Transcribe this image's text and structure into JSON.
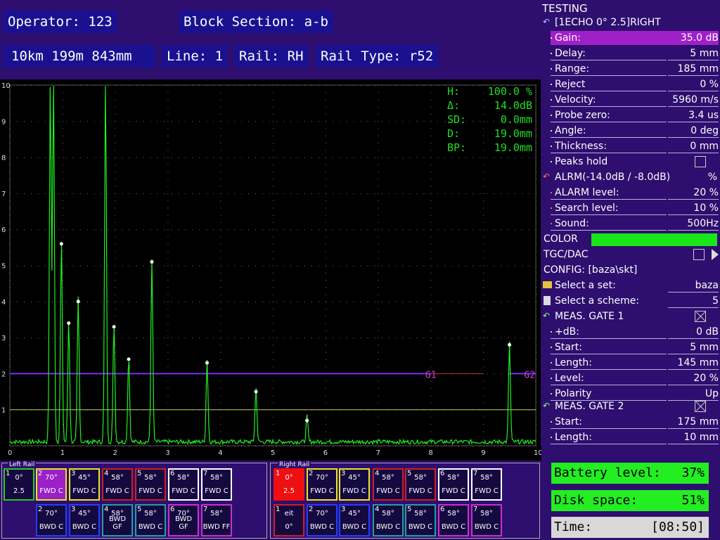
{
  "header": {
    "operator": "Operator: 123",
    "block_section": "Block Section: a-b",
    "distance": "10km 199m 843mm",
    "line": "Line: 1",
    "rail": "Rail: RH",
    "rail_type": "Rail Type: r52"
  },
  "scope": {
    "readouts": [
      {
        "label": "H:",
        "value": "100.0 %"
      },
      {
        "label": "Δ:",
        "value": "14.0dB"
      },
      {
        "label": "SD:",
        "value": "0.0mm"
      },
      {
        "label": "D:",
        "value": "19.0mm"
      },
      {
        "label": "BP:",
        "value": "19.0mm"
      }
    ],
    "y_ticks": [
      "1",
      "2",
      "3",
      "4",
      "5",
      "6",
      "7",
      "8",
      "9",
      "10"
    ],
    "x_ticks": [
      "0",
      "1",
      "2",
      "3",
      "4",
      "5",
      "6",
      "7",
      "8",
      "9",
      "10"
    ],
    "gate1_label": "G1",
    "gate2_label": "G2",
    "colors": {
      "signal": "#22ee22",
      "gate1": "#7b2cff",
      "gate2": "#c83030",
      "reference": "#c8c860"
    }
  },
  "chart_data": {
    "type": "line",
    "x_range": [
      0,
      10
    ],
    "y_range": [
      0,
      10
    ],
    "gates": [
      {
        "name": "G1",
        "level": 2.0,
        "start": 0,
        "end": 7.7
      },
      {
        "name": "G2",
        "level": 2.0,
        "start": 7.7,
        "end": 10
      }
    ],
    "reference_level": 1.0,
    "peaks": [
      {
        "x": 0.77,
        "y": 10.0
      },
      {
        "x": 0.83,
        "y": 10.0
      },
      {
        "x": 0.98,
        "y": 5.6
      },
      {
        "x": 1.12,
        "y": 3.4
      },
      {
        "x": 1.3,
        "y": 4.0
      },
      {
        "x": 1.82,
        "y": 10.0
      },
      {
        "x": 1.98,
        "y": 3.3
      },
      {
        "x": 2.26,
        "y": 2.4
      },
      {
        "x": 2.7,
        "y": 5.1
      },
      {
        "x": 3.75,
        "y": 2.3
      },
      {
        "x": 4.68,
        "y": 1.5
      },
      {
        "x": 5.65,
        "y": 0.7
      },
      {
        "x": 9.5,
        "y": 2.8
      }
    ]
  },
  "panel": {
    "title": "TESTING",
    "echo_header": "[1ECHO 0° 2.5]RIGHT",
    "rows": [
      {
        "label": "Gain:",
        "value": "35.0 dB",
        "selected": true
      },
      {
        "label": "Delay:",
        "value": "5 mm"
      },
      {
        "label": "Range:",
        "value": "185 mm"
      },
      {
        "label": "Reject",
        "value": "0 %"
      },
      {
        "label": "Velocity:",
        "value": "5960 m/s"
      },
      {
        "label": "Probe zero:",
        "value": "3.4 us"
      },
      {
        "label": "Angle:",
        "value": "0 deg"
      },
      {
        "label": "Thickness:",
        "value": "0 mm"
      },
      {
        "label": "Peaks hold",
        "value": ""
      }
    ],
    "alarm_header": "ALRM(-14.0dB / -8.0dB)",
    "alarm_unit": "%",
    "alarm_rows": [
      {
        "label": "ALARM level:",
        "value": "20 %"
      },
      {
        "label": "Search level:",
        "value": "10 %"
      },
      {
        "label": "Sound:",
        "value": "500Hz"
      }
    ],
    "color_label": "COLOR",
    "color_value": "#19e619",
    "tgc_label": "TGC/DAC",
    "config_label": "CONFIG: [baza\\skt]",
    "set_label": "Select a set:",
    "set_value": "baza",
    "scheme_label": "Select a scheme:",
    "scheme_value": "5",
    "gate1_header": "MEAS. GATE 1",
    "gate1_rows": [
      {
        "label": "+dB:",
        "value": "0 dB"
      },
      {
        "label": "Start:",
        "value": "5 mm"
      },
      {
        "label": "Length:",
        "value": "145 mm"
      },
      {
        "label": "Level:",
        "value": "20 %"
      },
      {
        "label": "Polarity",
        "value": "Up"
      }
    ],
    "gate2_header": "MEAS. GATE 2",
    "gate2_rows": [
      {
        "label": "Start:",
        "value": "175 mm"
      },
      {
        "label": "Length:",
        "value": "10 mm"
      }
    ]
  },
  "left_rail": {
    "title": "Left Rail",
    "top": [
      {
        "n": "1",
        "angle": "0°",
        "mode": "2.5",
        "color": "#22cc22",
        "bg": ""
      },
      {
        "n": "2",
        "angle": "70°",
        "mode": "FWD C",
        "color": "#e8e820",
        "bg": "#9a20c8"
      },
      {
        "n": "3",
        "angle": "45°",
        "mode": "FWD C",
        "color": "#e8e820",
        "bg": ""
      },
      {
        "n": "4",
        "angle": "58°",
        "mode": "FWD C",
        "color": "#cc2020",
        "bg": ""
      },
      {
        "n": "5",
        "angle": "58°",
        "mode": "FWD C",
        "color": "#cc2020",
        "bg": ""
      },
      {
        "n": "6",
        "angle": "58°",
        "mode": "FWD C",
        "color": "#ffffff",
        "bg": ""
      },
      {
        "n": "7",
        "angle": "58°",
        "mode": "FWD C",
        "color": "#ffffff",
        "bg": ""
      }
    ],
    "bottom": [
      {
        "n": "2",
        "angle": "70°",
        "mode": "BWD C",
        "color": "#2040ff"
      },
      {
        "n": "3",
        "angle": "45°",
        "mode": "BWD C",
        "color": "#2040ff"
      },
      {
        "n": "4",
        "angle": "58°",
        "mode": "BWD GF",
        "color": "#20a0a0"
      },
      {
        "n": "5",
        "angle": "58°",
        "mode": "BWD C",
        "color": "#20a0a0"
      },
      {
        "n": "6",
        "angle": "70°",
        "mode": "BWD GF",
        "color": "#cc30cc"
      },
      {
        "n": "7",
        "angle": "58°",
        "mode": "BWD FF",
        "color": "#cc30cc"
      }
    ]
  },
  "right_rail": {
    "title": "Right Rail",
    "top": [
      {
        "n": "1",
        "angle": "0°",
        "mode": "2.5",
        "color": "#ee1010",
        "bg": "#ee1010"
      },
      {
        "n": "2",
        "angle": "70°",
        "mode": "FWD C",
        "color": "#e8e820",
        "bg": ""
      },
      {
        "n": "3",
        "angle": "45°",
        "mode": "FWD C",
        "color": "#e8e820",
        "bg": ""
      },
      {
        "n": "4",
        "angle": "58°",
        "mode": "FWD C",
        "color": "#cc2020",
        "bg": ""
      },
      {
        "n": "5",
        "angle": "58°",
        "mode": "FWD C",
        "color": "#cc2020",
        "bg": ""
      },
      {
        "n": "6",
        "angle": "58°",
        "mode": "FWD C",
        "color": "#ffffff",
        "bg": ""
      },
      {
        "n": "7",
        "angle": "58°",
        "mode": "FWD C",
        "color": "#ffffff",
        "bg": ""
      }
    ],
    "bottom": [
      {
        "n": "1",
        "angle": "eit",
        "mode": "0°",
        "color": "#cc2020"
      },
      {
        "n": "2",
        "angle": "70°",
        "mode": "BWD C",
        "color": "#2040ff"
      },
      {
        "n": "3",
        "angle": "45°",
        "mode": "BWD C",
        "color": "#2040ff"
      },
      {
        "n": "4",
        "angle": "58°",
        "mode": "BWD C",
        "color": "#20a0a0"
      },
      {
        "n": "5",
        "angle": "58°",
        "mode": "BWD C",
        "color": "#20a0a0"
      },
      {
        "n": "6",
        "angle": "58°",
        "mode": "BWD C",
        "color": "#cc30cc"
      },
      {
        "n": "7",
        "angle": "58°",
        "mode": "BWD C",
        "color": "#cc30cc"
      }
    ]
  },
  "status": {
    "battery_label": "Battery level:",
    "battery_value": "37%",
    "disk_label": "Disk space:",
    "disk_value": "51%",
    "time_label": "Time:",
    "time_value": "[08:50]",
    "colors": {
      "ok": "#22ee22",
      "neutral": "#d8d8d8"
    }
  }
}
